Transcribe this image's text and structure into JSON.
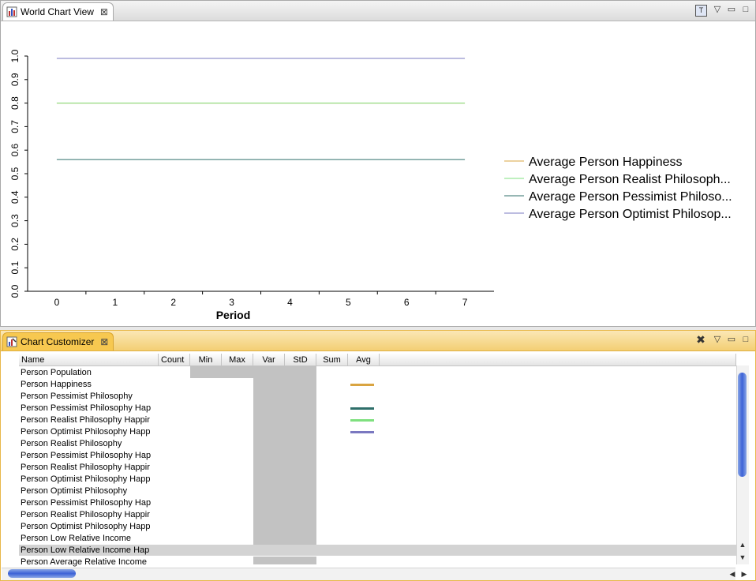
{
  "top_view": {
    "tab_title": "World Chart View",
    "tab_icon": "bar-chart-icon",
    "controls": [
      "text-toggle-icon",
      "view-menu-icon",
      "minimize-icon",
      "maximize-icon"
    ]
  },
  "bottom_view": {
    "tab_title": "Chart Customizer",
    "tab_icon": "chart-customize-icon",
    "controls": [
      "clear-icon",
      "view-menu-icon",
      "minimize-icon",
      "maximize-icon"
    ]
  },
  "chart_data": {
    "type": "line",
    "xlabel": "Period",
    "ylabel": "",
    "x": [
      0,
      1,
      2,
      3,
      4,
      5,
      6,
      7
    ],
    "xlim": [
      -0.5,
      7.5
    ],
    "ylim": [
      0.0,
      1.0
    ],
    "yticks": [
      "0.0",
      "0.1",
      "0.2",
      "0.3",
      "0.4",
      "0.5",
      "0.6",
      "0.7",
      "0.8",
      "0.9",
      "1.0"
    ],
    "xticks": [
      "0",
      "1",
      "2",
      "3",
      "4",
      "5",
      "6",
      "7"
    ],
    "legend_position": "right",
    "series": [
      {
        "name": "Average Person Happiness",
        "color": "#d9a441",
        "values": [
          0.8,
          0.8,
          0.8,
          0.8,
          0.8,
          0.8,
          0.8,
          0.8
        ]
      },
      {
        "name": "Average Person Realist Philosoph...",
        "color": "#7fe07f",
        "values": [
          0.8,
          0.8,
          0.8,
          0.8,
          0.8,
          0.8,
          0.8,
          0.8
        ]
      },
      {
        "name": "Average Person Pessimist Philoso...",
        "color": "#2f6f6a",
        "values": [
          0.56,
          0.56,
          0.56,
          0.56,
          0.56,
          0.56,
          0.56,
          0.56
        ]
      },
      {
        "name": "Average Person Optimist Philosop...",
        "color": "#7a78c0",
        "values": [
          0.99,
          0.99,
          0.99,
          0.99,
          0.99,
          0.99,
          0.99,
          0.99
        ]
      }
    ]
  },
  "table": {
    "columns": [
      "Name",
      "Count",
      "Min",
      "Max",
      "Var",
      "StD",
      "Sum",
      "Avg"
    ],
    "rows": [
      {
        "name": "Person Population",
        "swatch": null
      },
      {
        "name": "Person Happiness",
        "swatch": "#d9a441"
      },
      {
        "name": "Person Pessimist Philosophy",
        "swatch": null
      },
      {
        "name": "Person Pessimist Philosophy Hap",
        "swatch": "#2f6f6a"
      },
      {
        "name": "Person Realist Philosophy Happir",
        "swatch": "#7fe07f"
      },
      {
        "name": "Person Optimist Philosophy Happ",
        "swatch": "#7a78c0"
      },
      {
        "name": "Person Realist Philosophy",
        "swatch": null
      },
      {
        "name": "Person Pessimist Philosophy Hap",
        "swatch": null
      },
      {
        "name": "Person Realist Philosophy Happir",
        "swatch": null
      },
      {
        "name": "Person Optimist Philosophy Happ",
        "swatch": null
      },
      {
        "name": "Person Optimist Philosophy",
        "swatch": null
      },
      {
        "name": "Person Pessimist Philosophy Hap",
        "swatch": null
      },
      {
        "name": "Person Realist Philosophy Happir",
        "swatch": null
      },
      {
        "name": "Person Optimist Philosophy Happ",
        "swatch": null
      },
      {
        "name": "Person Low Relative Income",
        "swatch": null
      },
      {
        "name": "Person Low Relative Income Hap",
        "swatch": null
      },
      {
        "name": "Person Average Relative Income",
        "swatch": null
      }
    ],
    "selected_row": 15
  }
}
